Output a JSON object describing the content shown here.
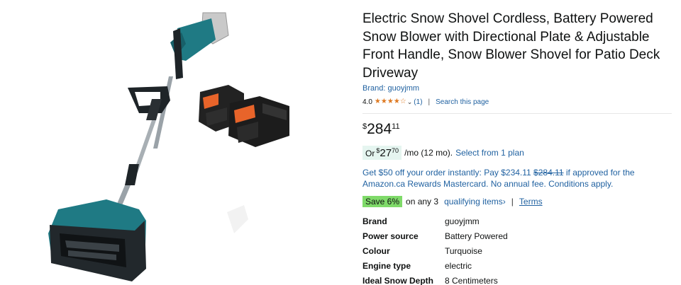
{
  "product": {
    "title": "Electric Snow Shovel Cordless, Battery Powered Snow Blower with Directional Plate & Adjustable Front Handle, Snow Blower Shovel for Patio Deck Driveway",
    "brand_link": "Brand: guoyjmm",
    "rating_value": "4.0",
    "rating_stars": 4.0,
    "review_count": "(1)",
    "separator": "|",
    "search_page": "Search this page",
    "image_icon": "snow-shovel-product-image"
  },
  "price": {
    "symbol": "$",
    "whole": "284",
    "fraction": "11"
  },
  "monthly": {
    "or": "Or",
    "symbol": "$",
    "whole": "27",
    "fraction": "70",
    "per_month": "/mo (12 mo).",
    "select_link": "Select from 1 plan"
  },
  "offer": {
    "before": "Get $50 off your order instantly: Pay $234.11 ",
    "strike": "$284.11",
    "after": " if approved for the Amazon.ca Rewards Mastercard. No annual fee. Conditions apply."
  },
  "promo": {
    "badge": "Save 6%",
    "on_any": "on any 3",
    "qualifying": "qualifying items›",
    "pipe": "|",
    "terms": "Terms"
  },
  "specs": [
    {
      "key": "Brand",
      "value": "guoyjmm"
    },
    {
      "key": "Power source",
      "value": "Battery Powered"
    },
    {
      "key": "Colour",
      "value": "Turquoise"
    },
    {
      "key": "Engine type",
      "value": "electric"
    },
    {
      "key": "Ideal Snow Depth",
      "value": "8 Centimeters"
    }
  ],
  "colors": {
    "link": "#2162a1",
    "star": "#de7921",
    "save_badge": "#7fda69",
    "monthly_bg": "#e5f5f0",
    "teal": "#1f7a84"
  }
}
